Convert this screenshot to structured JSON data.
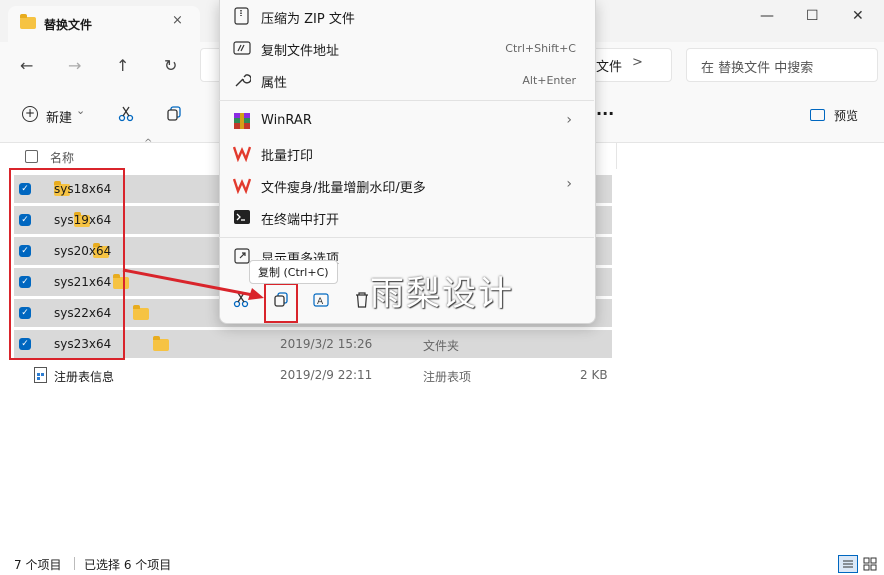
{
  "window": {
    "tab_title": "替换文件",
    "tab_close": "×",
    "minimize": "—",
    "maximize": "☐",
    "close": "✕"
  },
  "nav": {
    "back": "←",
    "forward": "→",
    "up": "↑",
    "refresh": "↻",
    "address_tail": "文件",
    "address_chevron": ">",
    "search_placeholder": "在 替换文件 中搜索"
  },
  "toolbar": {
    "new_label": "新建",
    "new_caret": "⌄",
    "more": "···",
    "preview_label": "预览"
  },
  "list": {
    "header_name": "名称",
    "rows": [
      {
        "name": "sys18x64",
        "selected": true
      },
      {
        "name": "sys19x64",
        "selected": true
      },
      {
        "name": "sys20x64",
        "selected": true
      },
      {
        "name": "sys21x64",
        "selected": true
      },
      {
        "name": "sys22x64",
        "selected": true
      },
      {
        "name": "sys23x64",
        "selected": true,
        "date": "2019/3/2 15:26",
        "type": "文件夹"
      }
    ],
    "registry": {
      "name": "注册表信息",
      "date": "2019/2/9 22:11",
      "type": "注册表项",
      "size": "2 KB"
    }
  },
  "context_menu": {
    "items": [
      {
        "label": "压缩为 ZIP 文件",
        "shortcut": "",
        "icon": "zip-icon"
      },
      {
        "label": "复制文件地址",
        "shortcut": "Ctrl+Shift+C",
        "icon": "copy-path-icon"
      },
      {
        "label": "属性",
        "shortcut": "Alt+Enter",
        "icon": "wrench-icon"
      },
      {
        "label": "WinRAR",
        "shortcut": "",
        "icon": "winrar-icon",
        "submenu": true
      },
      {
        "label": "批量打印",
        "shortcut": "",
        "icon": "wps-icon"
      },
      {
        "label": "文件瘦身/批量增删水印/更多",
        "shortcut": "",
        "icon": "wps-icon",
        "submenu": true
      },
      {
        "label": "在终端中打开",
        "shortcut": "",
        "icon": "terminal-icon"
      },
      {
        "label": "显示更多选项",
        "shortcut": "",
        "icon": "more-options-icon"
      }
    ],
    "tooltip": "复制 (Ctrl+C)"
  },
  "watermark": "雨梨设计",
  "status": {
    "count": "7 个项目",
    "selected": "已选择 6 个项目"
  },
  "colors": {
    "accent": "#0067c0",
    "highlight": "#d9242b",
    "folder": "#f6c343"
  }
}
